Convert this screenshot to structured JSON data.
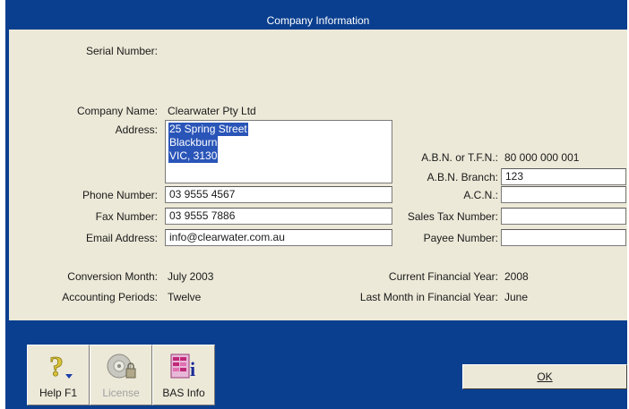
{
  "window": {
    "title": "Company Information"
  },
  "left": {
    "serial_label": "Serial Number:",
    "company_name_label": "Company Name:",
    "company_name_value": "Clearwater Pty Ltd",
    "address_label": "Address:",
    "address_lines": [
      "25 Spring Street",
      "Blackburn",
      "VIC, 3130"
    ],
    "phone_label": "Phone Number:",
    "phone_value": "03 9555 4567",
    "fax_label": "Fax Number:",
    "fax_value": "03 9555 7886",
    "email_label": "Email Address:",
    "email_value": "info@clearwater.com.au",
    "conversion_label": "Conversion Month:",
    "conversion_value": "July 2003",
    "periods_label": "Accounting Periods:",
    "periods_value": "Twelve"
  },
  "right": {
    "abn_label": "A.B.N. or T.F.N.:",
    "abn_value": "80 000 000 001",
    "branch_label": "A.B.N. Branch:",
    "branch_value": "123",
    "acn_label": "A.C.N.:",
    "acn_value": "",
    "sales_tax_label": "Sales Tax Number:",
    "sales_tax_value": "",
    "payee_label": "Payee Number:",
    "payee_value": "",
    "current_fy_label": "Current Financial Year:",
    "current_fy_value": "2008",
    "last_month_label": "Last Month in Financial Year:",
    "last_month_value": "June"
  },
  "toolbar": {
    "help_label": "Help F1",
    "license_label": "License",
    "bas_label": "BAS Info"
  },
  "ok_label": "OK",
  "colors": {
    "frame": "#0a3f8f",
    "panel": "#ece9d8",
    "selection": "#2a55b8"
  }
}
